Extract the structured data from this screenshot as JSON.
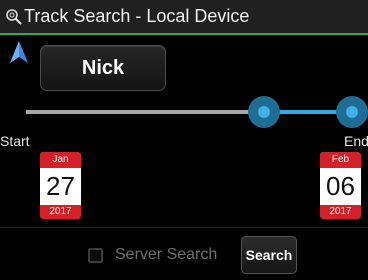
{
  "header": {
    "title": "Track Search - Local Device",
    "icon": "search-icon"
  },
  "nav": {
    "icon": "navigation-arrow-icon",
    "color": "#3d8be0"
  },
  "device": {
    "user_button_label": "Nick"
  },
  "range": {
    "start_label": "Start",
    "end_label": "End",
    "start_value": 0.73,
    "end_value": 1.0,
    "selected_color": "#35a9e0",
    "track_color": "#a8a8a8"
  },
  "start_date": {
    "month": "Jan",
    "day": "27",
    "year": "2017"
  },
  "end_date": {
    "month": "Feb",
    "day": "06",
    "year": "2017"
  },
  "footer": {
    "server_search_label": "Server Search",
    "server_search_checked": false,
    "search_button_label": "Search"
  },
  "colors": {
    "accent_line": "#3aa64a",
    "calendar_red": "#d32029"
  }
}
